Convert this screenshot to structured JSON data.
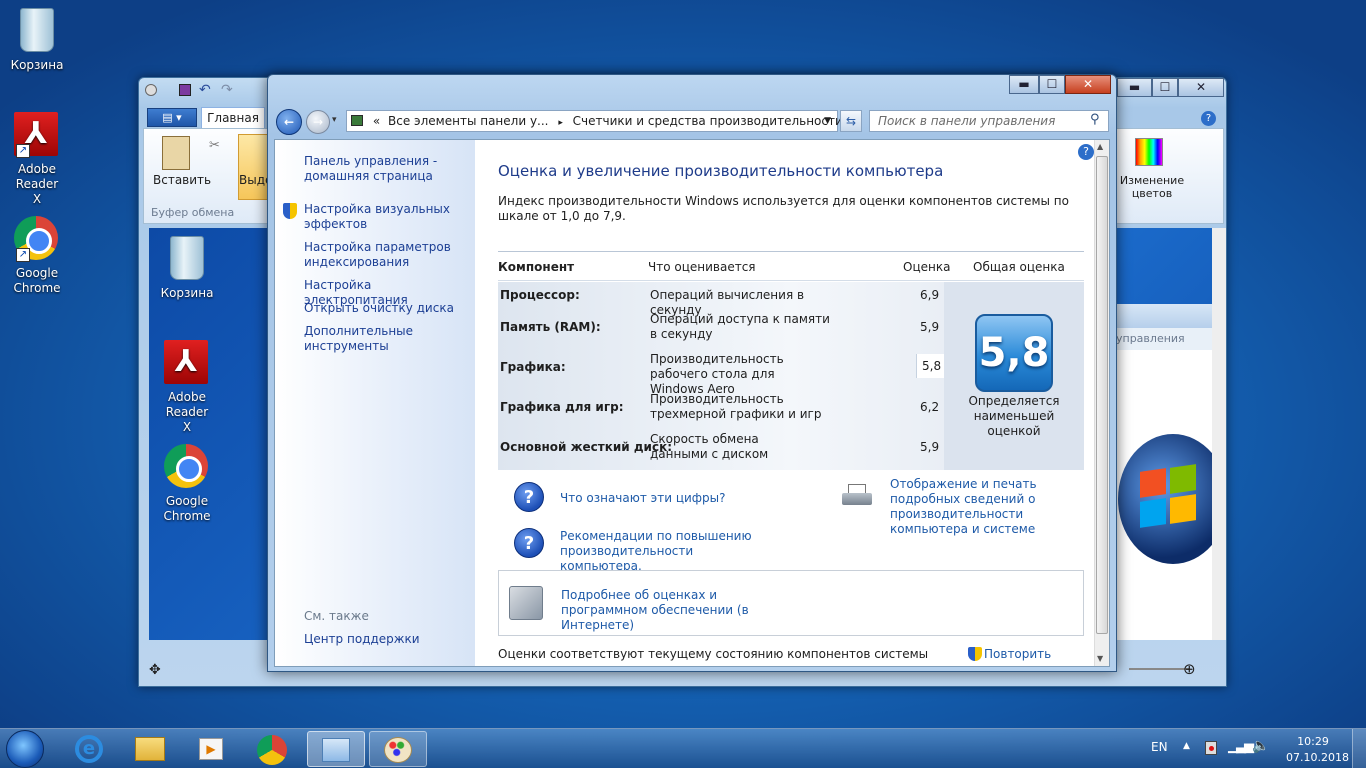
{
  "desktop": {
    "icons": [
      {
        "label": "Корзина"
      },
      {
        "label": "Adobe Reader X"
      },
      {
        "label": "Google Chrome"
      }
    ],
    "inner_icons": [
      {
        "label": "Корзина"
      },
      {
        "label": "Adobe Reader X"
      },
      {
        "label": "Google Chrome"
      }
    ]
  },
  "paint": {
    "tab_home": "Главная",
    "paste": "Вставить",
    "select": "Выде",
    "clipboard_group": "Буфер обмена",
    "edit_colors": "Изменение цветов",
    "inner_search_fragment": "управления"
  },
  "window": {
    "address": {
      "prefix": "«",
      "crumb1": "Все элементы панели у...",
      "sep": "▸",
      "crumb2": "Счетчики и средства производительности"
    },
    "search_placeholder": "Поиск в панели управления",
    "controls": {
      "min": "▬",
      "max": "☐",
      "close": "✕"
    }
  },
  "sidebar": {
    "home": "Панель управления - домашняя страница",
    "items": [
      "Настройка визуальных эффектов",
      "Настройка параметров индексирования",
      "Настройка электропитания",
      "Открыть очистку диска",
      "Дополнительные инструменты"
    ],
    "see_also": "См. также",
    "support": "Центр поддержки"
  },
  "main": {
    "title": "Оценка и увеличение производительности компьютера",
    "description": "Индекс производительности Windows используется для оценки компонентов системы по шкале от 1,0 до 7,9.",
    "headers": {
      "component": "Компонент",
      "what": "Что оценивается",
      "score": "Оценка",
      "total": "Общая оценка"
    },
    "rows": [
      {
        "component": "Процессор:",
        "what": "Операций вычисления в секунду",
        "score": "6,9"
      },
      {
        "component": "Память (RAM):",
        "what": "Операций доступа к памяти в секунду",
        "score": "5,9"
      },
      {
        "component": "Графика:",
        "what": "Производительность рабочего стола для Windows Aero",
        "score": "5,8"
      },
      {
        "component": "Графика для игр:",
        "what": "Производительность трехмерной графики и игр",
        "score": "6,2"
      },
      {
        "component": "Основной жесткий диск:",
        "what": "Скорость обмена данными с диском",
        "score": "5,9"
      }
    ],
    "base_score": "5,8",
    "base_note": "Определяется наименьшей оценкой",
    "link_numbers": "Что означают эти цифры?",
    "link_print": "Отображение и печать подробных сведений о производительности компьютера и системе",
    "link_tips": "Рекомендации по повышению производительности компьютера.",
    "link_online": "Подробнее об оценках и программном обеспечении (в Интернете)",
    "footer_status": "Оценки соответствуют текущему состоянию компонентов системы",
    "rerun": "Повторить оценку"
  },
  "taskbar": {
    "lang": "EN",
    "time": "10:29",
    "date": "07.10.2018"
  }
}
